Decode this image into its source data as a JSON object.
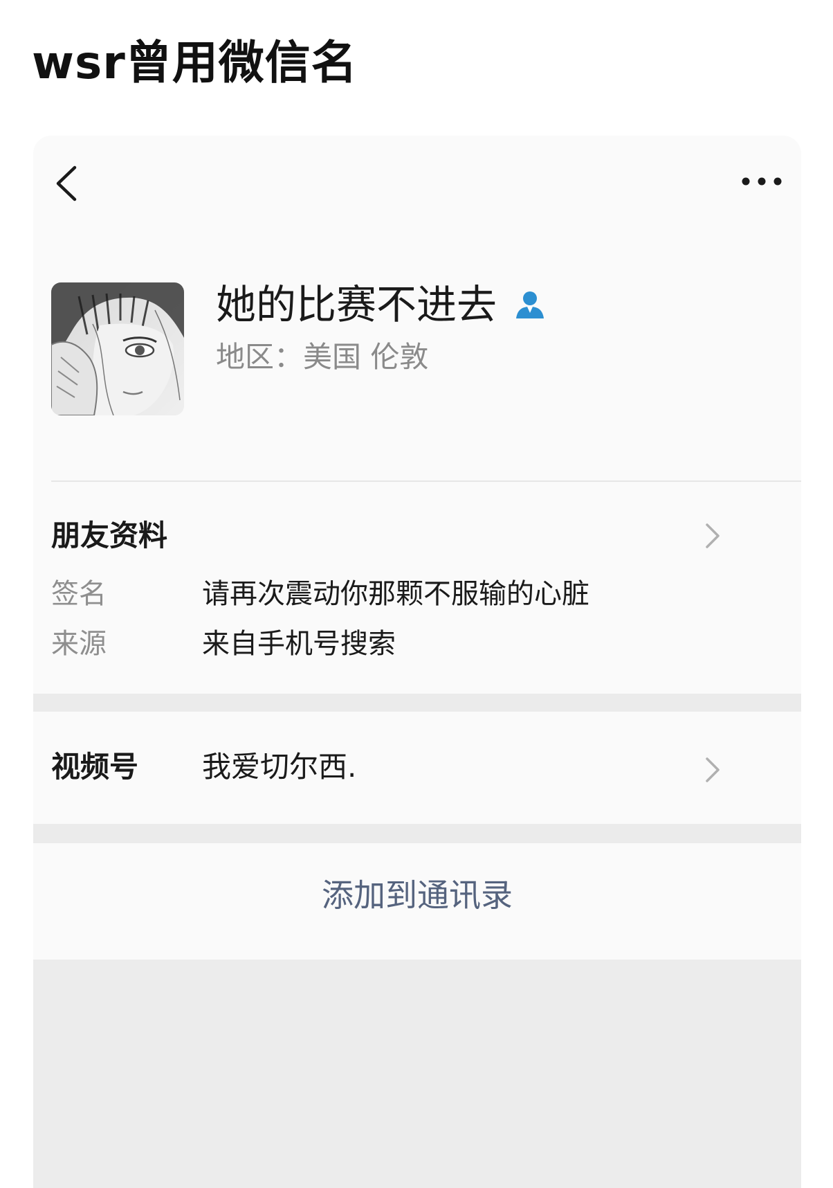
{
  "caption": "wsr曾用微信名",
  "profile": {
    "nickname": "她的比赛不进去",
    "region": "地区：美国 伦敦",
    "gender_icon": "person-icon",
    "avatar": "sketch-portrait-avatar"
  },
  "topbar": {
    "back_icon": "chevron-left-icon",
    "more_icon": "more-dots-icon"
  },
  "friend_info": {
    "title": "朋友资料",
    "rows": [
      {
        "label": "签名",
        "value": "请再次震动你那颗不服输的心脏"
      },
      {
        "label": "来源",
        "value": "来自手机号搜索"
      }
    ]
  },
  "channels": {
    "label": "视频号",
    "value": "我爱切尔西."
  },
  "actions": {
    "add_contact": "添加到通讯录"
  },
  "colors": {
    "accent_link": "#55637e",
    "gender_icon": "#2c8fd1",
    "muted_text": "#8e8e8e",
    "card_bg": "#fafafa",
    "gap_bg": "#ebebeb"
  }
}
